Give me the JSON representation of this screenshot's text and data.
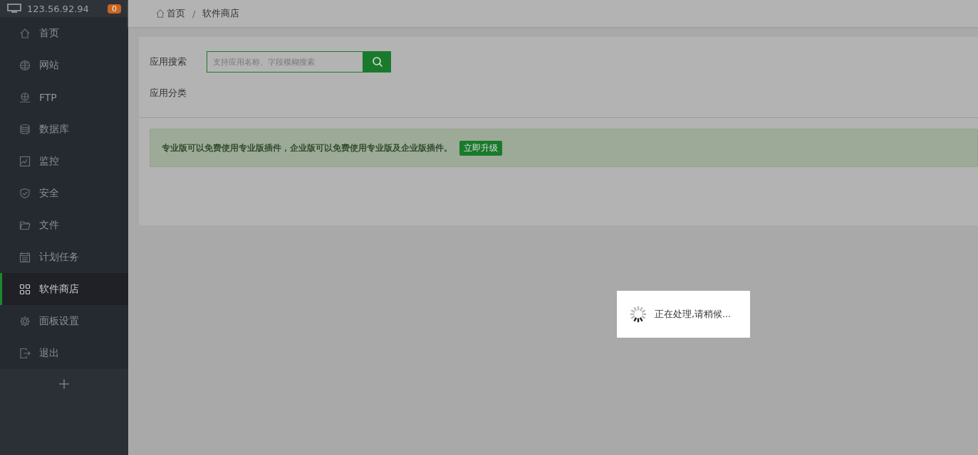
{
  "sidebar": {
    "host": "123.56.92.94",
    "badge": "0",
    "items": [
      {
        "label": "首页",
        "kind": "home",
        "selected": false
      },
      {
        "label": "网站",
        "kind": "globe",
        "selected": false
      },
      {
        "label": "FTP",
        "kind": "ftp",
        "selected": false
      },
      {
        "label": "数据库",
        "kind": "db",
        "selected": false
      },
      {
        "label": "监控",
        "kind": "monitor",
        "selected": false
      },
      {
        "label": "安全",
        "kind": "shield",
        "selected": false
      },
      {
        "label": "文件",
        "kind": "folder",
        "selected": false
      },
      {
        "label": "计划任务",
        "kind": "calendar",
        "selected": false
      },
      {
        "label": "软件商店",
        "kind": "grid",
        "selected": true
      },
      {
        "label": "面板设置",
        "kind": "gear",
        "selected": false
      },
      {
        "label": "退出",
        "kind": "exit",
        "selected": false
      }
    ],
    "add": "+"
  },
  "breadcrumb": {
    "separator": "/",
    "items": [
      "首页",
      "软件商店"
    ]
  },
  "search": {
    "label": "应用搜索",
    "placeholder": "支持应用名称、字段模糊搜索"
  },
  "category": {
    "label": "应用分类"
  },
  "notice": {
    "text": "专业版可以免费使用专业版插件，企业版可以免费使用专业版及企业版插件。",
    "button": "立即升级"
  },
  "loading": {
    "text": "正在处理,请稍候..."
  }
}
